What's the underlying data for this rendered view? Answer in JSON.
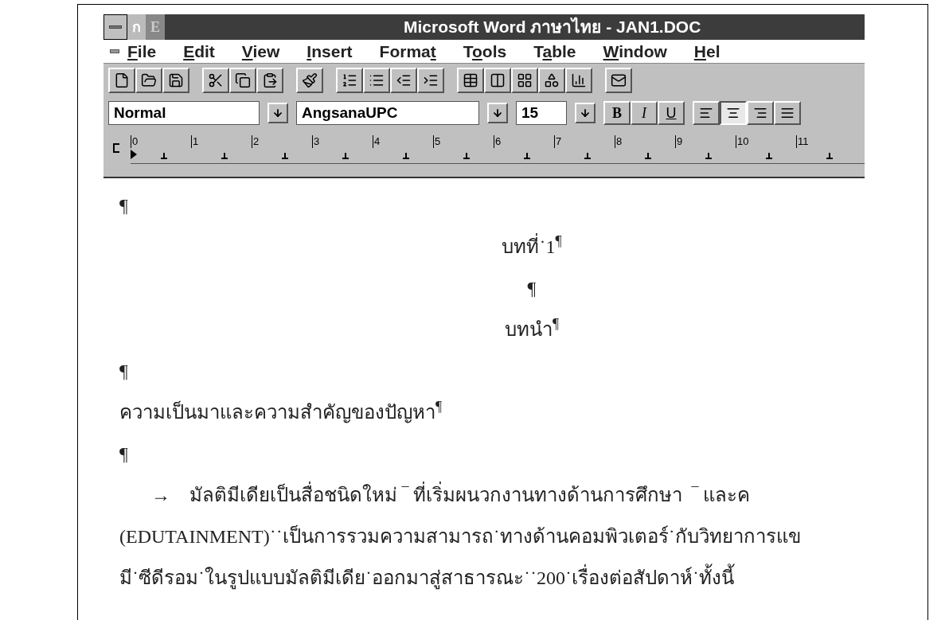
{
  "window": {
    "title": "Microsoft Word ภาษาไทย - JAN1.DOC",
    "indicators": [
      "ก",
      "E"
    ]
  },
  "menu": [
    {
      "key": "F",
      "post": "ile"
    },
    {
      "key": "E",
      "post": "dit"
    },
    {
      "key": "V",
      "post": "iew"
    },
    {
      "key": "I",
      "post": "nsert"
    },
    {
      "pre": "Forma",
      "key": "t"
    },
    {
      "pre": "T",
      "key": "o",
      "post": "ols"
    },
    {
      "pre": "T",
      "key": "a",
      "post": "ble"
    },
    {
      "key": "W",
      "post": "indow"
    },
    {
      "key": "H",
      "post": "el"
    }
  ],
  "formatting": {
    "style": "Normal",
    "font": "AngsanaUPC",
    "size": "15",
    "text_buttons": [
      {
        "label": "B",
        "kind": "bold"
      },
      {
        "label": "I",
        "kind": "italic"
      },
      {
        "label": "U",
        "kind": "underline"
      }
    ],
    "alignment": [
      {
        "kind": "left",
        "selected": false
      },
      {
        "kind": "center",
        "selected": true
      },
      {
        "kind": "right",
        "selected": false
      },
      {
        "kind": "justify",
        "selected": false
      }
    ]
  },
  "ruler": {
    "labels": [
      "0",
      "1",
      "2",
      "3",
      "4",
      "5",
      "6",
      "7",
      "8",
      "9",
      "10",
      "11"
    ]
  },
  "document": [
    {
      "kind": "mark",
      "text": "¶"
    },
    {
      "kind": "center",
      "text": "บทที่˙1$^{¶}$"
    },
    {
      "kind": "center",
      "text": "¶"
    },
    {
      "kind": "center",
      "text": "บทนำ$^{¶}$"
    },
    {
      "kind": "mark",
      "text": "¶"
    },
    {
      "kind": "left",
      "text": "ความเป็นมาและความสำคัญของปัญหา$^{¶}$"
    },
    {
      "kind": "mark",
      "text": "¶"
    },
    {
      "kind": "indent",
      "text": "→    มัลติมีเดียเป็นสื่อชนิดใหม่ ‾ ที่เริ่มผนวกงานทางด้านการศึกษา  ‾ และค"
    },
    {
      "kind": "left",
      "text": "(EDUTAINMENT)˙˙เป็นการรวมความสามารถ˙ทางด้านคอมพิวเตอร์˙กับวิทยาการแข"
    },
    {
      "kind": "left",
      "text": "มี˙ซีดีรอม˙ในรูปแบบมัลติมีเดีย˙ออกมาสู่สาธารณะ˙˙200˙เรื่องต่อสัปดาห์˙ทั้งนี้"
    }
  ]
}
